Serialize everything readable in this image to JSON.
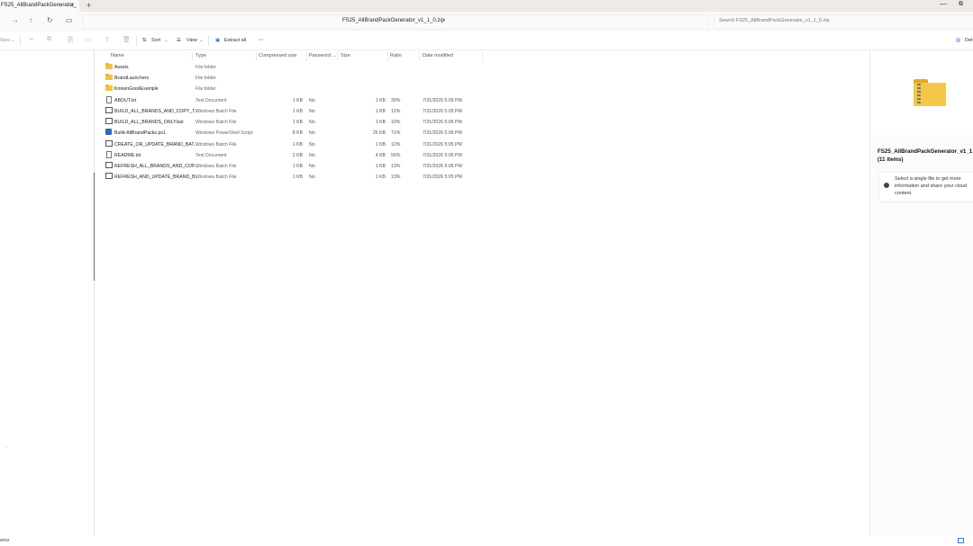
{
  "tab": {
    "title": "FS25_AllBrandPackGenerator_",
    "close": "✕",
    "new": "+"
  },
  "window": {
    "minimize": "—",
    "maximize": "⧉"
  },
  "nav": {
    "back": "←",
    "forward": "→",
    "up": "↑",
    "refresh": "↻",
    "pc": "▭"
  },
  "address": {
    "path": "FS25_AllBrandPackGenerator_v1_1_0.zip",
    "chevron": "›"
  },
  "search": {
    "placeholder": "Search FS25_AllBrandPackGenerator_v1_1_0.zip"
  },
  "commands": {
    "new": "New",
    "new_chevron": "⌄",
    "sort": "Sort",
    "view": "View",
    "extract_all": "Extract all",
    "more": "···",
    "details": "Det"
  },
  "icons": {
    "cut": "cut-icon",
    "copy": "copy-icon",
    "paste": "paste-icon",
    "rename": "rename-icon",
    "share": "share-icon",
    "delete": "delete-icon"
  },
  "columns": {
    "name": "Name",
    "type": "Type",
    "compressed": "Compressed size",
    "password": "Password ...",
    "size": "Size",
    "ratio": "Ratio",
    "date": "Date modified"
  },
  "files": [
    {
      "icon": "folder",
      "name": "Assets",
      "type": "File folder",
      "compressed": "",
      "password": "",
      "size": "",
      "ratio": "",
      "date": ""
    },
    {
      "icon": "folder",
      "name": "BrandLaunchers",
      "type": "File folder",
      "compressed": "",
      "password": "",
      "size": "",
      "ratio": "",
      "date": ""
    },
    {
      "icon": "folder",
      "name": "KnownGoodExample",
      "type": "File folder",
      "compressed": "",
      "password": "",
      "size": "",
      "ratio": "",
      "date": ""
    },
    {
      "icon": "doc",
      "name": "ABOUT.txt",
      "type": "Text Document",
      "compressed": "1 KB",
      "password": "No",
      "size": "1 KB",
      "ratio": "30%",
      "date": "7/31/2026 5:05 PM"
    },
    {
      "icon": "bat",
      "name": "BUILD_ALL_BRANDS_AND_COPY_T...",
      "type": "Windows Batch File",
      "compressed": "1 KB",
      "password": "No",
      "size": "1 KB",
      "ratio": "12%",
      "date": "7/31/2026 5:05 PM"
    },
    {
      "icon": "bat",
      "name": "BUILD_ALL_BRANDS_ONLY.bat",
      "type": "Windows Batch File",
      "compressed": "1 KB",
      "password": "No",
      "size": "1 KB",
      "ratio": "10%",
      "date": "7/31/2026 5:05 PM"
    },
    {
      "icon": "ps",
      "name": "Build-AllBrandPacks.ps1",
      "type": "Windows PowerShell Script",
      "compressed": "8 KB",
      "password": "No",
      "size": "25 KB",
      "ratio": "71%",
      "date": "7/31/2026 5:05 PM"
    },
    {
      "icon": "bat",
      "name": "CREATE_OR_UPDATE_BRAND_BAT...",
      "type": "Windows Batch File",
      "compressed": "1 KB",
      "password": "No",
      "size": "1 KB",
      "ratio": "12%",
      "date": "7/31/2026 5:05 PM"
    },
    {
      "icon": "doc",
      "name": "README.txt",
      "type": "Text Document",
      "compressed": "2 KB",
      "password": "No",
      "size": "4 KB",
      "ratio": "56%",
      "date": "7/31/2026 5:05 PM"
    },
    {
      "icon": "bat",
      "name": "REFRESH_ALL_BRANDS_AND_COP...",
      "type": "Windows Batch File",
      "compressed": "1 KB",
      "password": "No",
      "size": "1 KB",
      "ratio": "13%",
      "date": "7/31/2026 5:05 PM"
    },
    {
      "icon": "bat",
      "name": "REFRESH_AND_UPDATE_BRAND_B...",
      "type": "Windows Batch File",
      "compressed": "1 KB",
      "password": "No",
      "size": "1 KB",
      "ratio": "13%",
      "date": "7/31/2026 5:05 PM"
    }
  ],
  "details": {
    "title": "FS25_AllBrandPackGenerator_v1_1",
    "count": "(11 items)",
    "info_lines": [
      "Select a single file to get more",
      "information and share your cloud",
      "content."
    ]
  },
  "status": {
    "text": "ems"
  },
  "colors": {
    "folder": "#f4c245",
    "accent": "#3b73c4",
    "titlebar": "#eeeae4"
  }
}
